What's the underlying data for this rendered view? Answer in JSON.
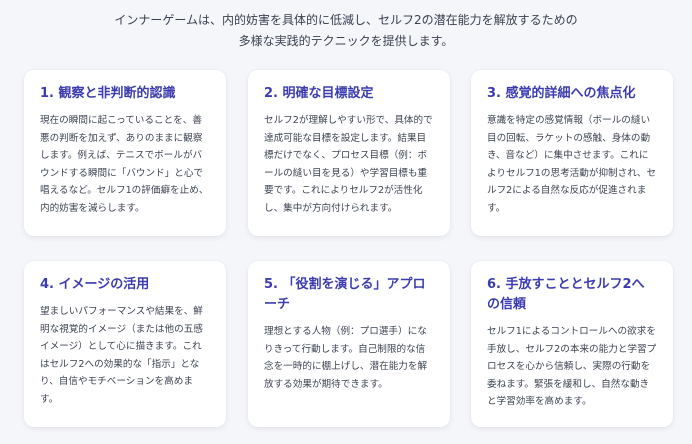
{
  "intro": "インナーゲームは、内的妨害を具体的に低減し、セルフ2の潜在能力を解放するための多様な実践的テクニックを提供します。",
  "colors": {
    "background": "#f5f6fa",
    "card": "#ffffff",
    "title": "#3c3cb0",
    "text": "#3d4452"
  },
  "cards": [
    {
      "title": "1. 観察と非判断的認識",
      "body": "現在の瞬間に起こっていることを、善悪の判断を加えず、ありのままに観察します。例えば、テニスでボールがバウンドする瞬間に「バウンド」と心で唱えるなど。セルフ1の評価癖を止め、内的妨害を減らします。"
    },
    {
      "title": "2. 明確な目標設定",
      "body": "セルフ2が理解しやすい形で、具体的で達成可能な目標を設定します。結果目標だけでなく、プロセス目標（例：ボールの縫い目を見る）や学習目標も重要です。これによりセルフ2が活性化し、集中が方向付けられます。"
    },
    {
      "title": "3. 感覚的詳細への焦点化",
      "body": "意識を特定の感覚情報（ボールの縫い目の回転、ラケットの感触、身体の動き、音など）に集中させます。これによりセルフ1の思考活動が抑制され、セルフ2による自然な反応が促進されます。"
    },
    {
      "title": "4. イメージの活用",
      "body": "望ましいパフォーマンスや結果を、鮮明な視覚的イメージ（または他の五感イメージ）として心に描きます。これはセルフ2への効果的な「指示」となり、自信やモチベーションを高めます。"
    },
    {
      "title": "5. 「役割を演じる」アプローチ",
      "body": "理想とする人物（例：プロ選手）になりきって行動します。自己制限的な信念を一時的に棚上げし、潜在能力を解放する効果が期待できます。"
    },
    {
      "title": "6. 手放すこととセルフ2への信頼",
      "body": "セルフ1によるコントロールへの欲求を手放し、セルフ2の本来の能力と学習プロセスを心から信頼し、実際の行動を委ねます。緊張を緩和し、自然な動きと学習効率を高めます。"
    }
  ]
}
